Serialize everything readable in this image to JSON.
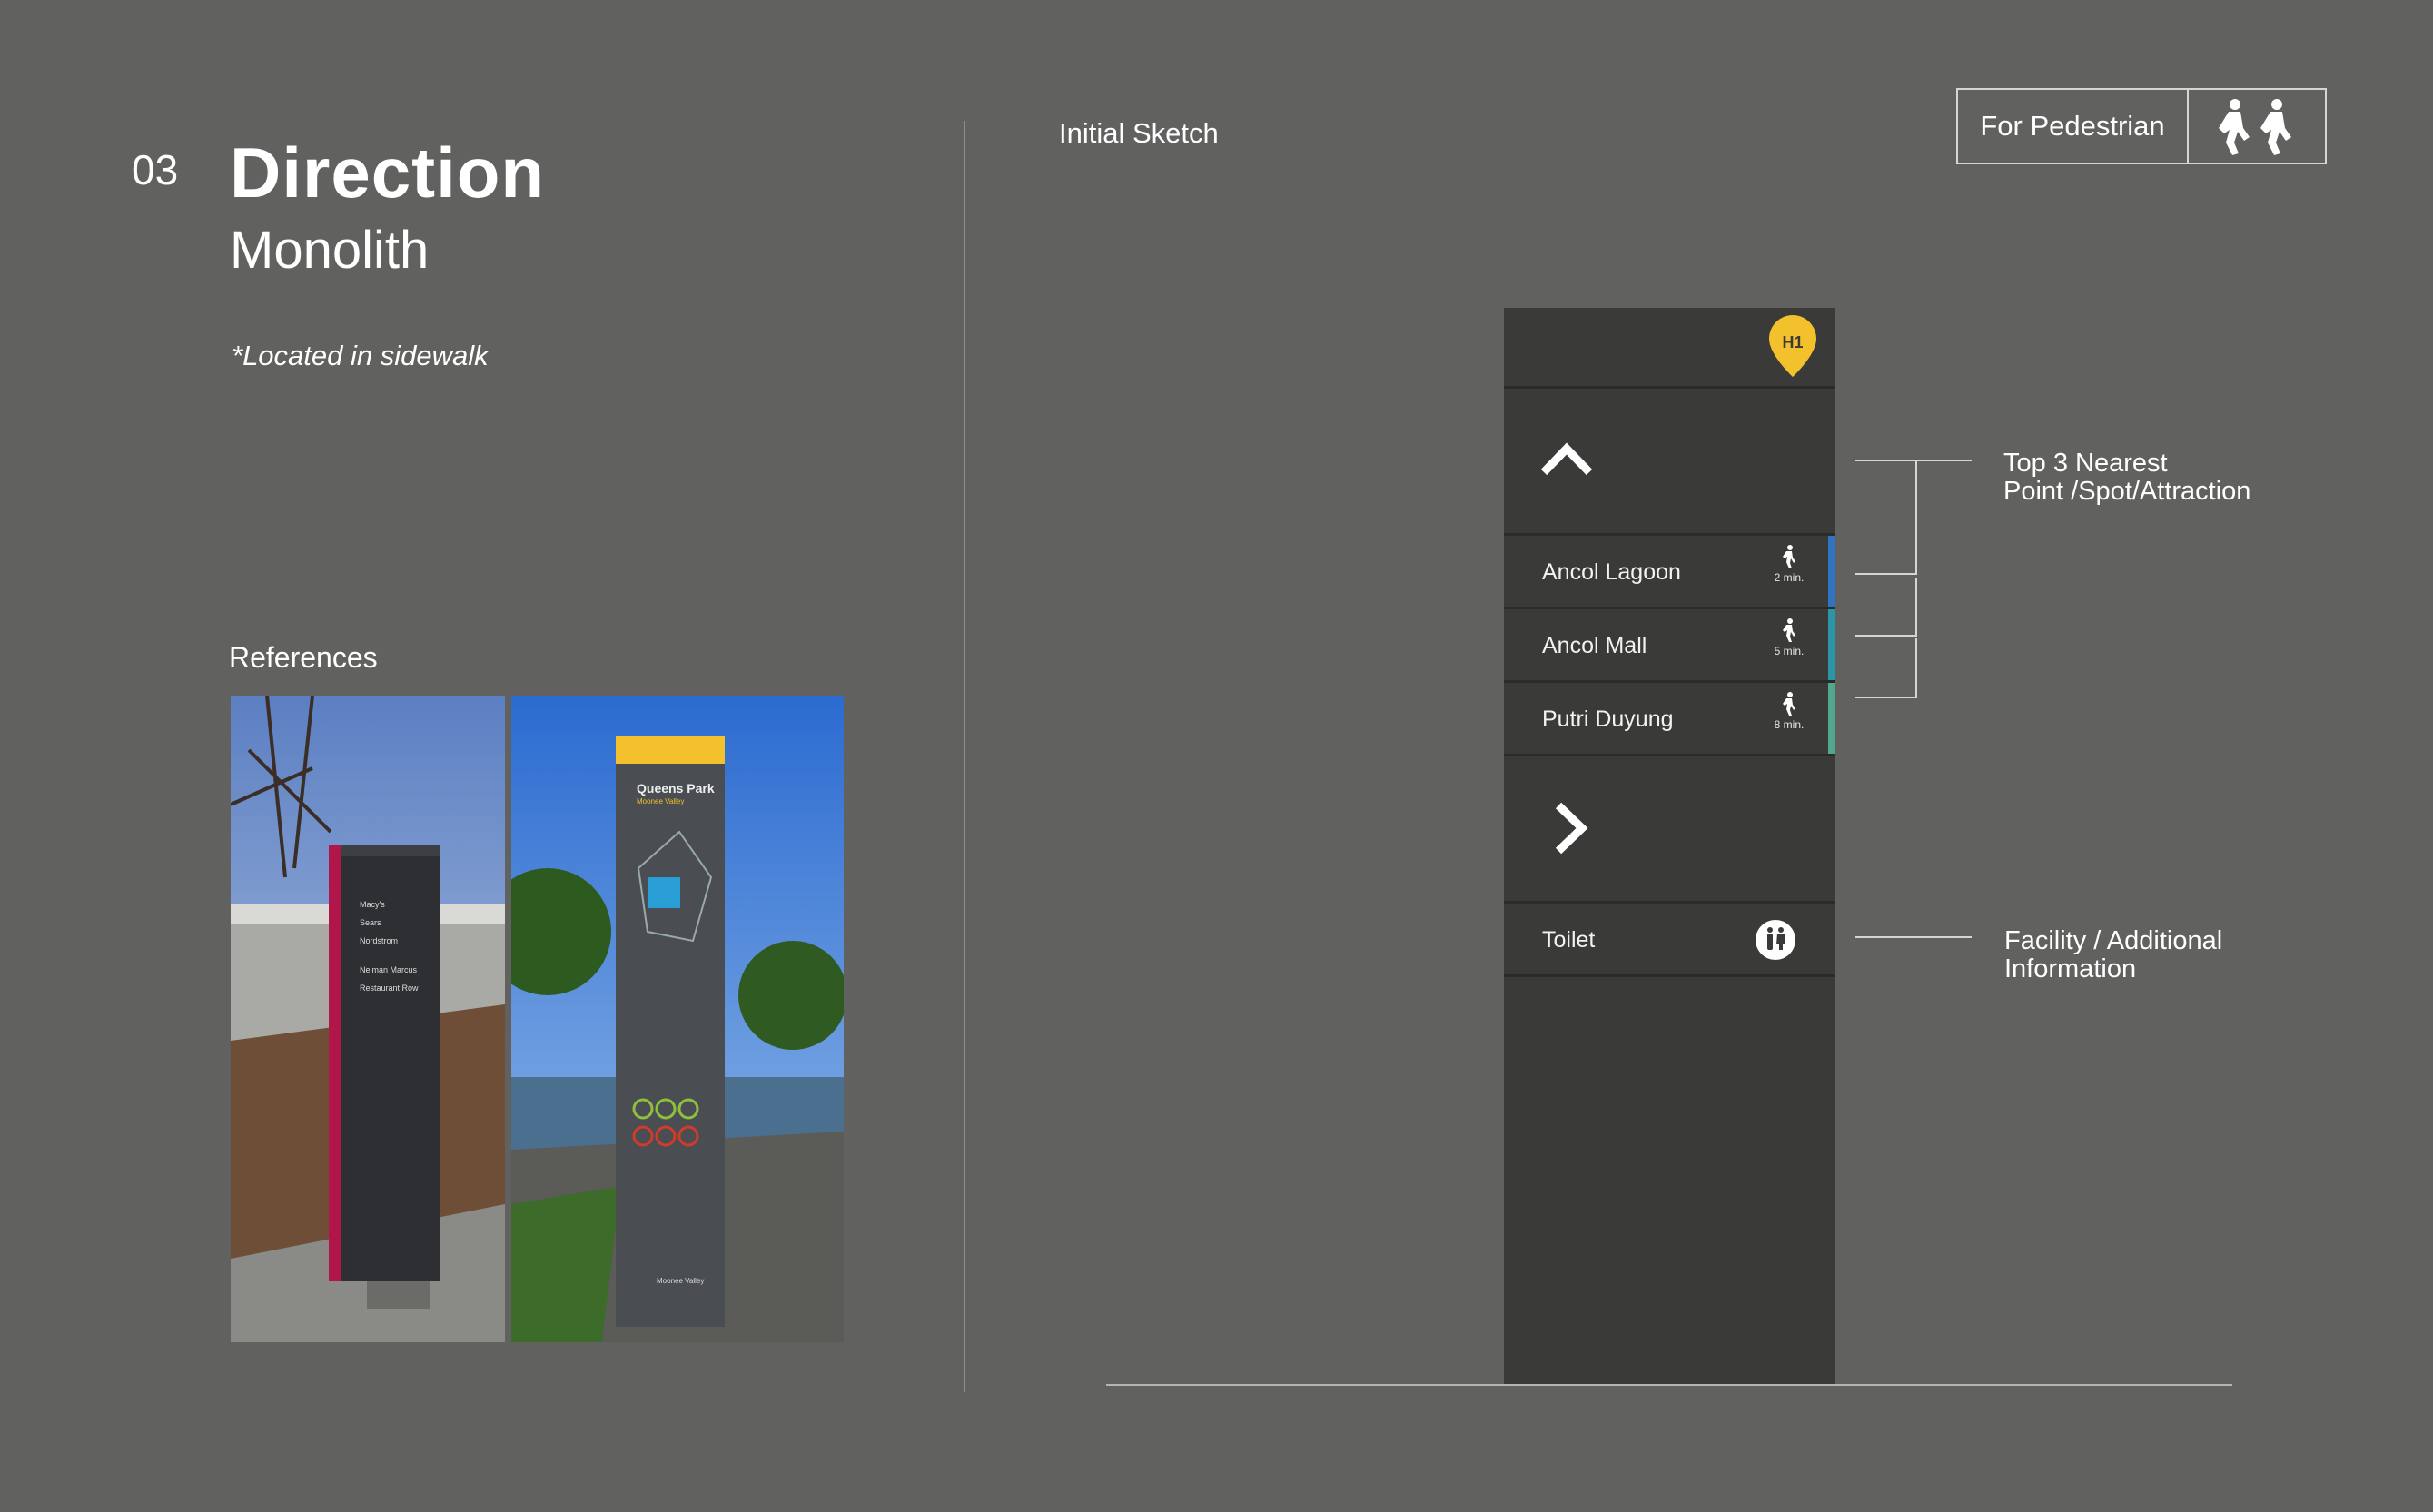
{
  "header": {
    "section_number": "03",
    "title": "Direction",
    "subtitle": "Monolith",
    "note": "*Located in sidewalk"
  },
  "references": {
    "label": "References",
    "photo1": {
      "items": [
        "Macy's",
        "Sears",
        "Nordstrom",
        "Neiman Marcus",
        "Restaurant Row"
      ]
    },
    "photo2": {
      "title": "Queens Park",
      "subtitle": "Moonee Valley",
      "footer": "Moonee Valley"
    }
  },
  "sketch": {
    "label": "Initial Sketch",
    "badge": "H1",
    "destinations": [
      {
        "name": "Ancol Lagoon",
        "time": "2 min.",
        "color": "#2e74c2"
      },
      {
        "name": "Ancol Mall",
        "time": "5 min.",
        "color": "#2a96a6"
      },
      {
        "name": "Putri Duyung",
        "time": "8 min.",
        "color": "#52a78c"
      }
    ],
    "facility": {
      "name": "Toilet",
      "icon": "toilet-icon"
    }
  },
  "mode": {
    "label": "For Pedestrian",
    "icon": "pedestrian-icon"
  },
  "annotations": {
    "top3_line1": "Top 3 Nearest",
    "top3_line2": "Point /Spot/Attraction",
    "facility_line1": "Facility / Additional",
    "facility_line2": "Information"
  },
  "colors": {
    "background": "#616160",
    "panel": "#3a3a39",
    "badge": "#f3c12b",
    "accent_red": "#b1164a",
    "accent_yellow": "#f3c12b"
  }
}
